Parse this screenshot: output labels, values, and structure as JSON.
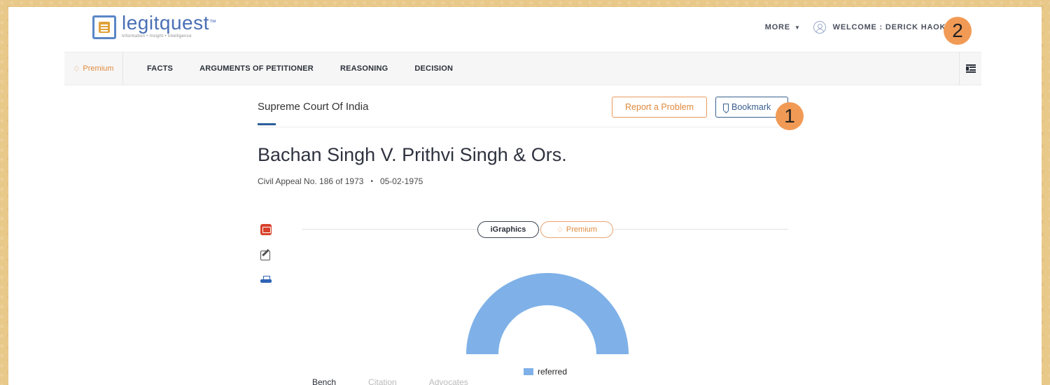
{
  "header": {
    "logo_name": "legitquest",
    "logo_tm": "™",
    "logo_tagline": "Information • Insight • Intelligence",
    "more_label": "MORE",
    "welcome_label": "WELCOME : DERICK HAOKIP"
  },
  "annotations": {
    "badge_1": "1",
    "badge_2": "2"
  },
  "nav": {
    "premium_label": "Premium",
    "items": [
      "FACTS",
      "ARGUMENTS OF PETITIONER",
      "REASONING",
      "DECISION"
    ]
  },
  "case": {
    "court": "Supreme Court Of India",
    "report_label": "Report a Problem",
    "bookmark_label": "Bookmark",
    "title": "Bachan Singh V. Prithvi Singh & Ors.",
    "appeal": "Civil Appeal No. 186 of 1973",
    "separator": "•",
    "date": "05-02-1975"
  },
  "igraphics": {
    "label": "iGraphics",
    "premium_label": "Premium"
  },
  "chart_data": {
    "type": "pie",
    "style": "half-donut",
    "series": [
      {
        "name": "referred",
        "values": [
          1
        ]
      }
    ],
    "colors": [
      "#7fb1e8"
    ],
    "legend": [
      "referred"
    ],
    "legend_position": "bottom"
  },
  "tabs": [
    "Bench",
    "Citation",
    "Advocates"
  ],
  "icons": {
    "mail": "envelope-icon",
    "edit": "edit-note-icon",
    "print": "print-icon"
  }
}
